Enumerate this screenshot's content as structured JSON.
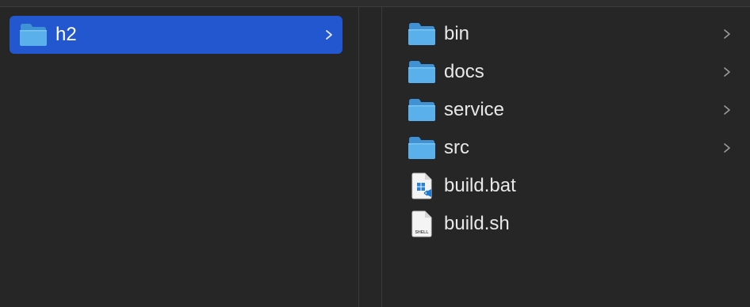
{
  "left_column": {
    "items": [
      {
        "label": "h2",
        "kind": "folder",
        "selected": true,
        "has_chevron": true
      }
    ]
  },
  "right_column": {
    "items": [
      {
        "label": "bin",
        "kind": "folder",
        "has_chevron": true
      },
      {
        "label": "docs",
        "kind": "folder",
        "has_chevron": true
      },
      {
        "label": "service",
        "kind": "folder",
        "has_chevron": true
      },
      {
        "label": "src",
        "kind": "folder",
        "has_chevron": true
      },
      {
        "label": "build.bat",
        "kind": "bat-file",
        "has_chevron": false
      },
      {
        "label": "build.sh",
        "kind": "shell-file",
        "icon_text": "SHELL",
        "has_chevron": false
      }
    ]
  },
  "colors": {
    "background": "#262626",
    "selection": "#2257d0",
    "folder_body": "#5ab0ea",
    "folder_tab": "#3f93d4",
    "text": "#e8e8e8",
    "chevron": "#9a9a9a"
  }
}
